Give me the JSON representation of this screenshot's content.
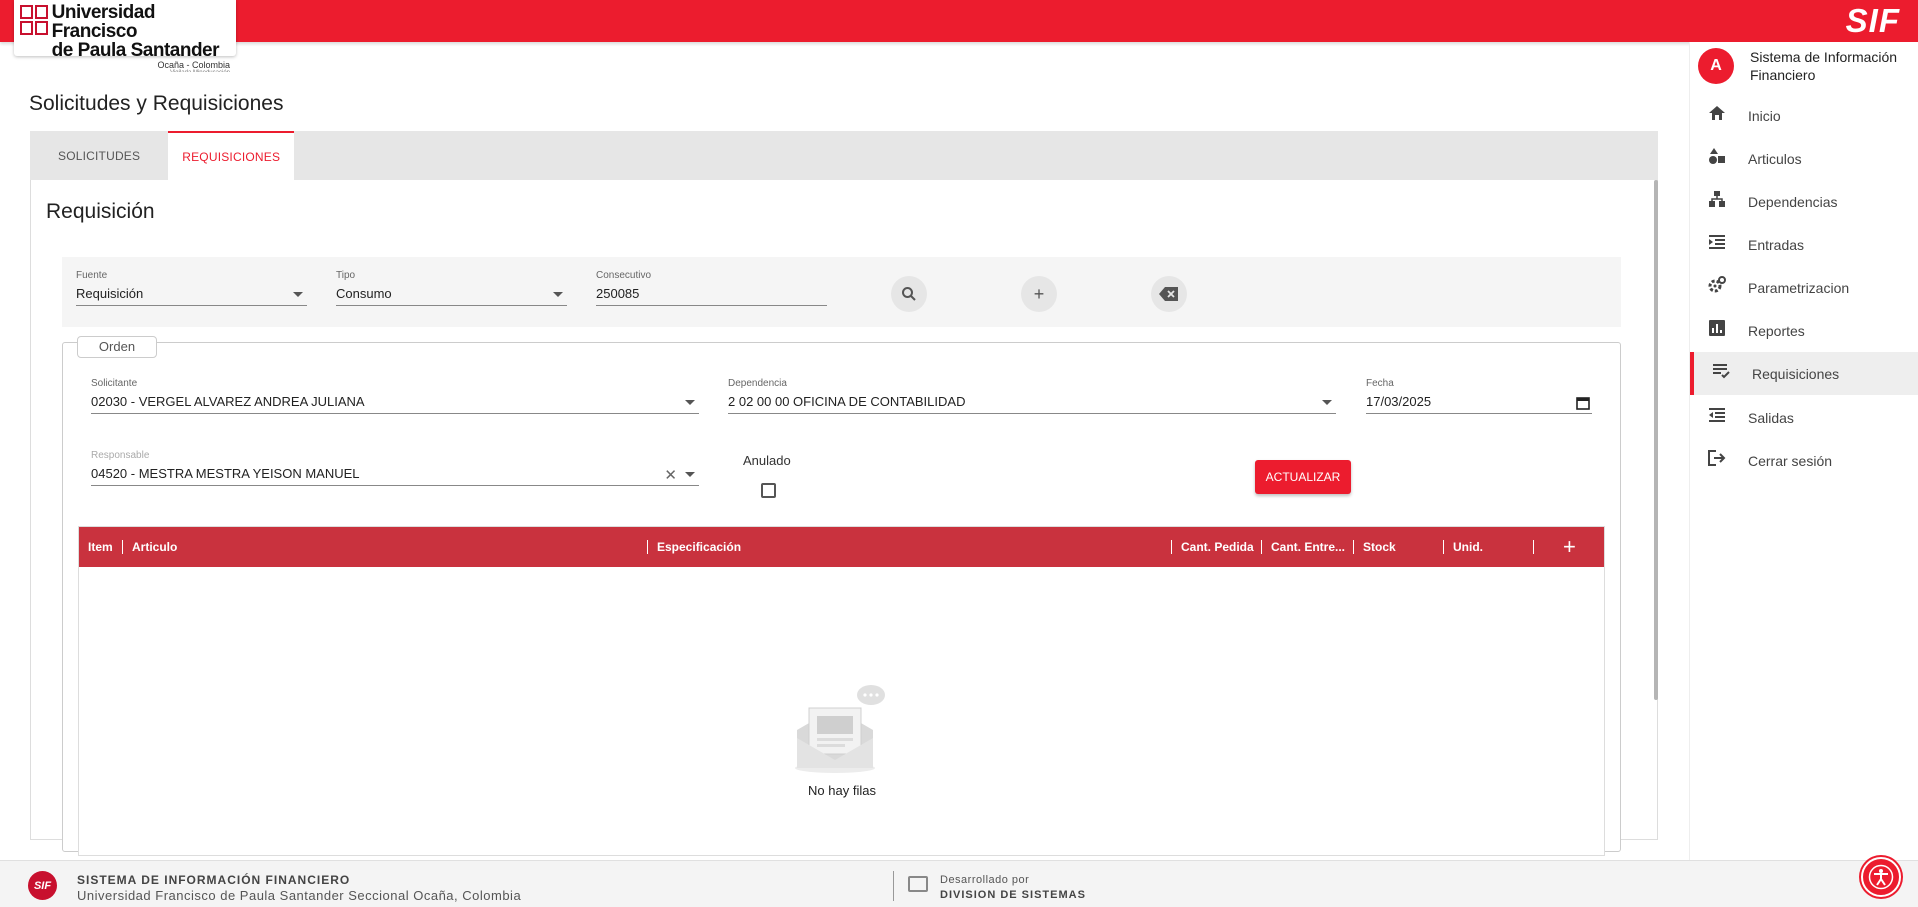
{
  "header": {
    "logo": {
      "line1": "Universidad Francisco",
      "line2": "de Paula Santander",
      "line3": "Ocaña - Colombia",
      "line4": "Vigilada Mineducación"
    },
    "brand": "SIF",
    "brand_color": "#ec1c2e"
  },
  "page": {
    "title": "Solicitudes y Requisiciones",
    "tabs": [
      {
        "label": "SOLICITUDES",
        "active": false
      },
      {
        "label": "REQUISICIONES",
        "active": true
      }
    ],
    "section_title": "Requisición"
  },
  "filters": {
    "fuente": {
      "label": "Fuente",
      "value": "Requisición"
    },
    "tipo": {
      "label": "Tipo",
      "value": "Consumo"
    },
    "consecutivo": {
      "label": "Consecutivo",
      "value": "250085"
    },
    "buttons": [
      "search-icon",
      "plus-icon",
      "backspace-icon"
    ]
  },
  "orden": {
    "label": "Orden",
    "solicitante": {
      "label": "Solicitante",
      "value": "02030 - VERGEL ALVAREZ ANDREA JULIANA"
    },
    "dependencia": {
      "label": "Dependencia",
      "value": "2 02 00 00 OFICINA DE CONTABILIDAD"
    },
    "fecha": {
      "label": "Fecha",
      "value": "17/03/2025"
    },
    "responsable": {
      "label": "Responsable",
      "value": "04520 - MESTRA MESTRA YEISON MANUEL"
    },
    "anulado": {
      "label": "Anulado",
      "checked": false
    },
    "actualizar_label": "ACTUALIZAR"
  },
  "grid": {
    "columns": [
      "Item",
      "Articulo",
      "Especificación",
      "Cant. Pedida",
      "Cant. Entre...",
      "Stock",
      "Unid."
    ],
    "add_label": "+",
    "empty_message": "No hay filas",
    "rows": []
  },
  "sidebar": {
    "avatar_letter": "A",
    "title": "Sistema de Información Financiero",
    "items": [
      {
        "label": "Inicio",
        "icon": "home-icon",
        "active": false
      },
      {
        "label": "Articulos",
        "icon": "shapes-icon",
        "active": false
      },
      {
        "label": "Dependencias",
        "icon": "hierarchy-icon",
        "active": false
      },
      {
        "label": "Entradas",
        "icon": "indent-icon",
        "active": false
      },
      {
        "label": "Parametrizacion",
        "icon": "settings-icon",
        "active": false
      },
      {
        "label": "Reportes",
        "icon": "bar-chart-icon",
        "active": false
      },
      {
        "label": "Requisiciones",
        "icon": "list-check-icon",
        "active": true
      },
      {
        "label": "Salidas",
        "icon": "outdent-icon",
        "active": false
      },
      {
        "label": "Cerrar sesión",
        "icon": "logout-icon",
        "active": false
      }
    ]
  },
  "footer": {
    "logo": "SIF",
    "title": "SISTEMA DE INFORMACIÓN FINANCIERO",
    "subtitle": "Universidad Francisco de Paula Santander Seccional Ocaña, Colombia",
    "dev_label": "Desarrollado por",
    "dev_name": "DIVISION DE SISTEMAS"
  }
}
